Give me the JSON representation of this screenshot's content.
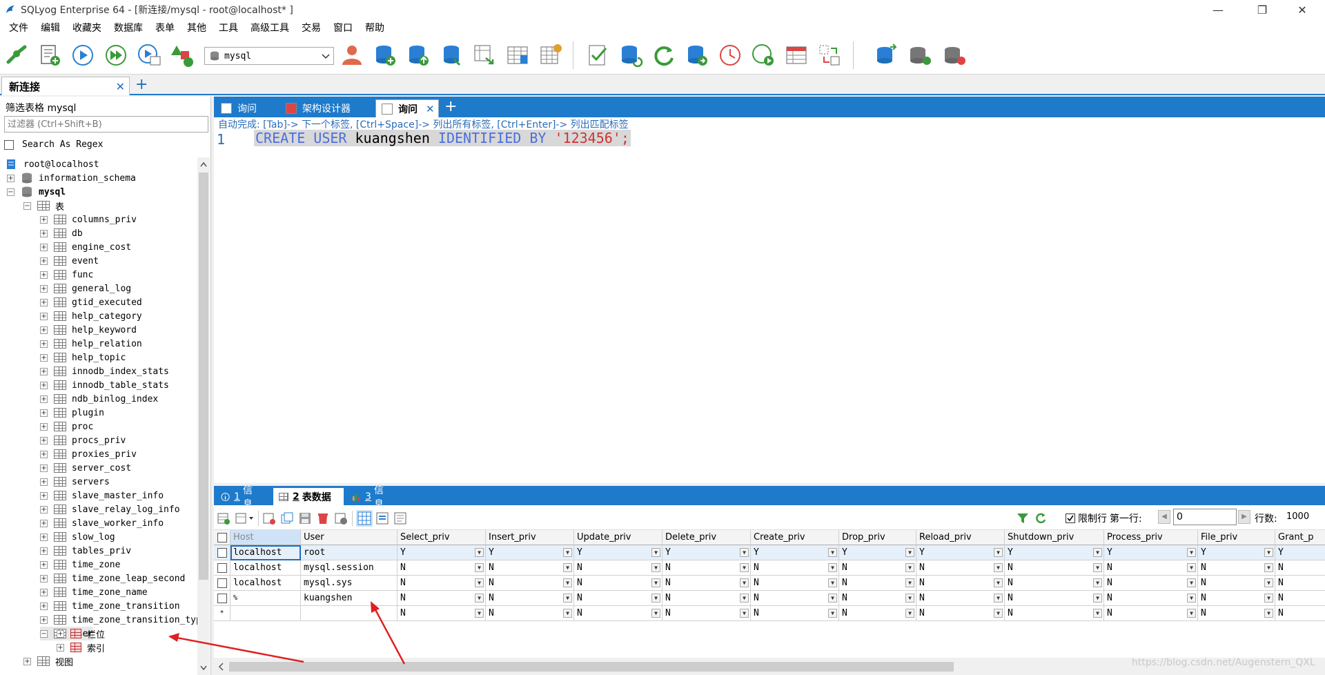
{
  "window": {
    "title": "SQLyog Enterprise 64 - [新连接/mysql - root@localhost* ]"
  },
  "menu": [
    "文件",
    "编辑",
    "收藏夹",
    "数据库",
    "表单",
    "其他",
    "工具",
    "高级工具",
    "交易",
    "窗口",
    "帮助"
  ],
  "toolbar": {
    "db_selected": "mysql"
  },
  "connection_tab": {
    "label": "新连接"
  },
  "left_panel": {
    "filter_label": "筛选表格 mysql",
    "filter_placeholder": "过滤器 (Ctrl+Shift+B)",
    "regex_label": "Search As Regex",
    "root": "root@localhost",
    "db_info_schema": "information_schema",
    "db_mysql": "mysql",
    "tables_folder": "表",
    "tables": [
      "columns_priv",
      "db",
      "engine_cost",
      "event",
      "func",
      "general_log",
      "gtid_executed",
      "help_category",
      "help_keyword",
      "help_relation",
      "help_topic",
      "innodb_index_stats",
      "innodb_table_stats",
      "ndb_binlog_index",
      "plugin",
      "proc",
      "procs_priv",
      "proxies_priv",
      "server_cost",
      "servers",
      "slave_master_info",
      "slave_relay_log_info",
      "slave_worker_info",
      "slow_log",
      "tables_priv",
      "time_zone",
      "time_zone_leap_second",
      "time_zone_name",
      "time_zone_transition",
      "time_zone_transition_typ",
      "user"
    ],
    "user_children": [
      "栏位",
      "索引"
    ],
    "views_folder": "视图"
  },
  "query_tabs": {
    "tab1": "询问",
    "tab2": "架构设计器",
    "tab3": "询问"
  },
  "editor": {
    "hint": "自动完成: [Tab]-> 下一个标签, [Ctrl+Space]-> 列出所有标签, [Ctrl+Enter]-> 列出匹配标签",
    "line_no": "1",
    "kw1": "CREATE USER",
    "ident": "kuangshen",
    "kw2": "IDENTIFIED BY",
    "str": "'123456';"
  },
  "result_tabs": {
    "t1_num": "1",
    "t1": "信息",
    "t2_num": "2",
    "t2": "表数据",
    "t3_num": "3",
    "t3": "信息"
  },
  "result_toolbar": {
    "limit_label": "限制行",
    "first_row_label": "第一行:",
    "first_row_value": "0",
    "rows_label": "行数:",
    "rows_value": "1000"
  },
  "grid": {
    "columns": [
      "Host",
      "User",
      "Select_priv",
      "Insert_priv",
      "Update_priv",
      "Delete_priv",
      "Create_priv",
      "Drop_priv",
      "Reload_priv",
      "Shutdown_priv",
      "Process_priv",
      "File_priv",
      "Grant_p"
    ],
    "rows": [
      [
        "localhost",
        "root",
        "Y",
        "Y",
        "Y",
        "Y",
        "Y",
        "Y",
        "Y",
        "Y",
        "Y",
        "Y",
        "Y"
      ],
      [
        "localhost",
        "mysql.session",
        "N",
        "N",
        "N",
        "N",
        "N",
        "N",
        "N",
        "N",
        "N",
        "N",
        "N"
      ],
      [
        "localhost",
        "mysql.sys",
        "N",
        "N",
        "N",
        "N",
        "N",
        "N",
        "N",
        "N",
        "N",
        "N",
        "N"
      ],
      [
        "%",
        "kuangshen",
        "N",
        "N",
        "N",
        "N",
        "N",
        "N",
        "N",
        "N",
        "N",
        "N",
        "N"
      ],
      [
        "",
        "",
        "N",
        "N",
        "N",
        "N",
        "N",
        "N",
        "N",
        "N",
        "N",
        "N",
        "N"
      ]
    ],
    "new_row_marker": "*"
  },
  "watermark": "https://blog.csdn.net/Augenstern_QXL",
  "colors": {
    "accent": "#1e7acb",
    "annotation_arrow": "#e02020"
  }
}
